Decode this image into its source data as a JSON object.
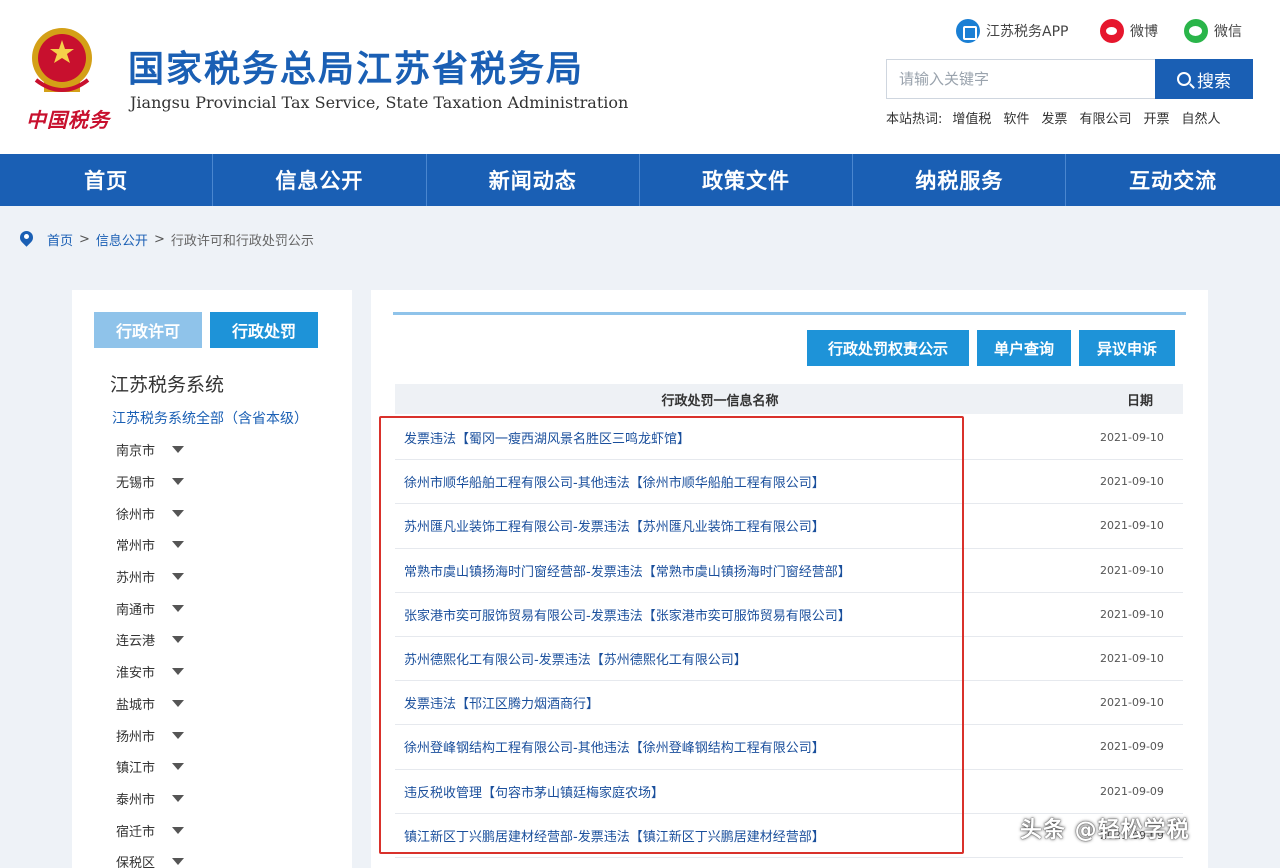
{
  "header": {
    "emblem_icon": "tax-emblem",
    "brand_signature": "中国税务",
    "title": "国家税务总局江苏省税务局",
    "subtitle": "Jiangsu Provincial Tax Service, State Taxation Administration",
    "social": {
      "app": "江苏税务APP",
      "weibo": "微博",
      "weixin": "微信"
    },
    "search": {
      "placeholder": "请输入关键字",
      "button": "搜索"
    },
    "hotwords": {
      "label": "本站热词:",
      "items": [
        "增值税",
        "软件",
        "发票",
        "有限公司",
        "开票",
        "自然人"
      ]
    }
  },
  "nav": {
    "items": [
      "首页",
      "信息公开",
      "新闻动态",
      "政策文件",
      "纳税服务",
      "互动交流"
    ]
  },
  "breadcrumb": {
    "items": [
      "首页",
      "信息公开",
      "行政许可和行政处罚公示"
    ],
    "separator": ">"
  },
  "sidebar": {
    "tabs": [
      "行政许可",
      "行政处罚"
    ],
    "heading": "江苏税务系统",
    "all_link": "江苏税务系统全部（含省本级）",
    "cities": [
      "南京市",
      "无锡市",
      "徐州市",
      "常州市",
      "苏州市",
      "南通市",
      "连云港",
      "淮安市",
      "盐城市",
      "扬州市",
      "镇江市",
      "泰州市",
      "宿迁市",
      "保税区"
    ]
  },
  "main": {
    "buttons": [
      "行政处罚权责公示",
      "单户查询",
      "异议申诉"
    ],
    "table": {
      "headers": [
        "行政处罚一信息名称",
        "日期"
      ],
      "rows": [
        {
          "name": "发票违法【蜀冈一瘦西湖风景名胜区三鸣龙虾馆】",
          "date": "2021-09-10"
        },
        {
          "name": "徐州市顺华船舶工程有限公司-其他违法【徐州市顺华船舶工程有限公司】",
          "date": "2021-09-10"
        },
        {
          "name": "苏州匯凡业装饰工程有限公司-发票违法【苏州匯凡业装饰工程有限公司】",
          "date": "2021-09-10"
        },
        {
          "name": "常熟市虞山镇扬海时门窗经营部-发票违法【常熟市虞山镇扬海时门窗经营部】",
          "date": "2021-09-10"
        },
        {
          "name": "张家港市奕可服饰贸易有限公司-发票违法【张家港市奕可服饰贸易有限公司】",
          "date": "2021-09-10"
        },
        {
          "name": "苏州德熙化工有限公司-发票违法【苏州德熙化工有限公司】",
          "date": "2021-09-10"
        },
        {
          "name": "发票违法【邗江区腾力烟酒商行】",
          "date": "2021-09-10"
        },
        {
          "name": "徐州登峰钢结构工程有限公司-其他违法【徐州登峰钢结构工程有限公司】",
          "date": "2021-09-09"
        },
        {
          "name": "违反税收管理【句容市茅山镇廷梅家庭农场】",
          "date": "2021-09-09"
        },
        {
          "name": "镇江新区丁兴鹏居建材经营部-发票违法【镇江新区丁兴鹏居建材经营部】",
          "date": "2021-09-09"
        }
      ]
    }
  },
  "watermark": "头条 @轻松学税",
  "colors": {
    "brand_blue": "#1a5fb4",
    "tab_light": "#8fc3ea",
    "tab_active": "#1e93d8",
    "highlight_red": "#d9312b"
  }
}
